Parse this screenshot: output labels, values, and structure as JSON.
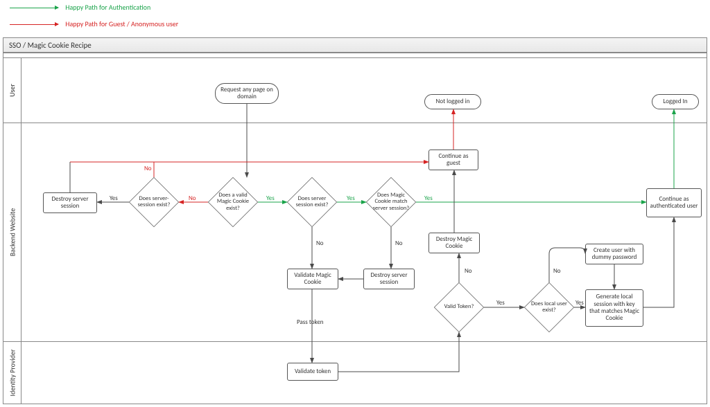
{
  "legend": {
    "auth": {
      "label": "Happy Path for Authentication",
      "color": "#1aa34a"
    },
    "guest": {
      "label": "Happy Path for Guest / Anonymous user",
      "color": "#d62424"
    }
  },
  "title": "SSO / Magic Cookie Recipe",
  "lanes": {
    "user": "User",
    "backend": "Backend Website",
    "idp": "Identity Provider"
  },
  "nodes": {
    "request": "Request any page on domain",
    "not_logged_in": "Not logged in",
    "logged_in": "Logged In",
    "destroy_server_session": "Destroy server session",
    "server_session_exist_q": "Does server-session exist?",
    "valid_cookie_q": "Does a valid Magic Cookie exist?",
    "server_session_exist_q2": "Does server session exist?",
    "cookie_match_q": "Does Magic Cookie match server session?",
    "continue_guest": "Continue as guest",
    "continue_auth": "Continue as authenticated user",
    "validate_cookie": "Validate Magic Cookie",
    "destroy_server_session2": "Destroy server session",
    "destroy_magic_cookie": "Destroy Magic Cookie",
    "valid_token_q": "Valid Token?",
    "local_user_q": "Does local user exist?",
    "create_user": "Create user with dummy password",
    "gen_session": "Generate local session with key that matches Magic Cookie",
    "validate_token": "Validate token",
    "pass_token": "Pass token"
  },
  "edge_labels": {
    "yes": "Yes",
    "no": "No"
  },
  "colors": {
    "default": "#4a4a4a",
    "green": "#1aa34a",
    "red": "#d62424"
  }
}
